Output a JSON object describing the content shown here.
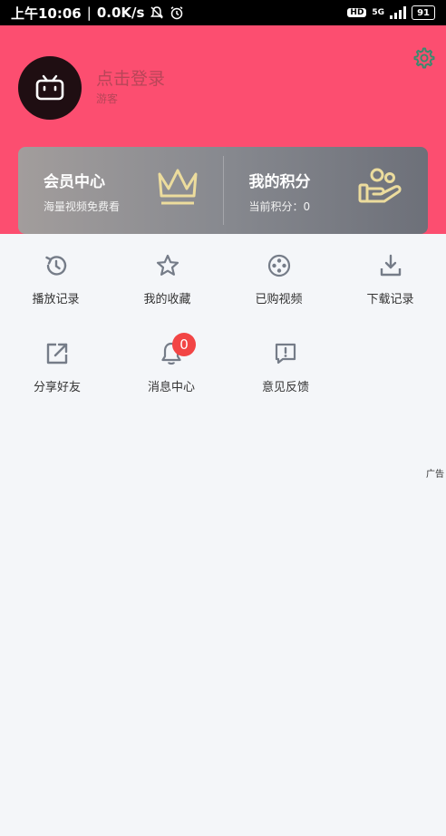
{
  "status_bar": {
    "time": "上午10:06",
    "speed": "0.0K/s",
    "hd": "HD",
    "network": "5G",
    "battery": "91"
  },
  "profile": {
    "login_prompt": "点击登录",
    "role": "游客"
  },
  "cards": {
    "vip": {
      "title": "会员中心",
      "subtitle": "海量视频免费看"
    },
    "points": {
      "title": "我的积分",
      "subtitle": "当前积分：0"
    }
  },
  "grid": {
    "row1": [
      {
        "label": "播放记录",
        "icon": "history-icon"
      },
      {
        "label": "我的收藏",
        "icon": "star-icon"
      },
      {
        "label": "已购视频",
        "icon": "film-reel-icon"
      },
      {
        "label": "下载记录",
        "icon": "download-icon"
      }
    ],
    "row2": [
      {
        "label": "分享好友",
        "icon": "share-icon"
      },
      {
        "label": "消息中心",
        "icon": "bell-icon",
        "badge": "0"
      },
      {
        "label": "意见反馈",
        "icon": "feedback-icon"
      }
    ]
  },
  "ad": {
    "label": "广告"
  },
  "colors": {
    "header": "#fc4e70",
    "accent_gold": "#ecdc9d",
    "icon_gray": "#757c88"
  }
}
